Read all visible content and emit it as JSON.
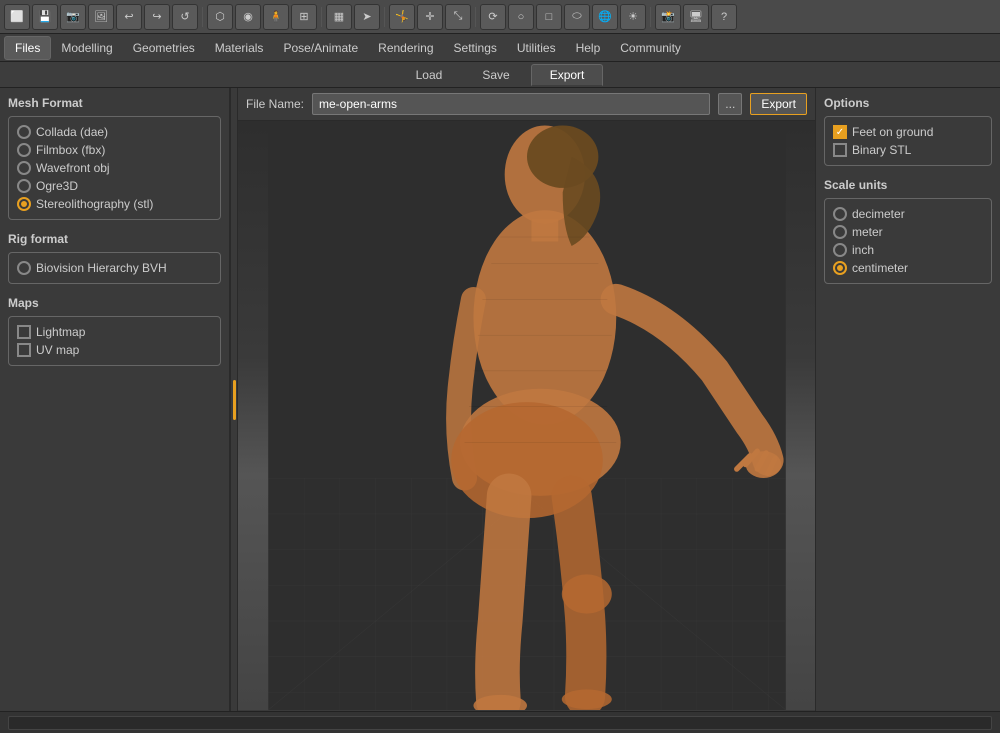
{
  "toolbar": {
    "tools": [
      {
        "name": "window-icon",
        "symbol": "⬜"
      },
      {
        "name": "disk-icon",
        "symbol": "💾"
      },
      {
        "name": "camera-icon",
        "symbol": "📷"
      },
      {
        "name": "render-icon",
        "symbol": "🖼"
      },
      {
        "name": "undo-icon",
        "symbol": "↩"
      },
      {
        "name": "redo-icon",
        "symbol": "↪"
      },
      {
        "name": "reset-icon",
        "symbol": "↺"
      },
      {
        "name": "mesh-icon",
        "symbol": "⬡"
      },
      {
        "name": "sphere-icon",
        "symbol": "◉"
      },
      {
        "name": "figure-icon",
        "symbol": "🧍"
      },
      {
        "name": "grid-icon",
        "symbol": "⊞"
      },
      {
        "name": "texture-icon",
        "symbol": "▦"
      },
      {
        "name": "arrow-icon",
        "symbol": "➤"
      },
      {
        "name": "pose-icon",
        "symbol": "🤸"
      },
      {
        "name": "move-icon",
        "symbol": "✛"
      },
      {
        "name": "scale-icon",
        "symbol": "⤡"
      },
      {
        "name": "rotate-icon",
        "symbol": "⟳"
      },
      {
        "name": "circle-icon",
        "symbol": "○"
      },
      {
        "name": "box-icon",
        "symbol": "□"
      },
      {
        "name": "cylinder-icon",
        "symbol": "⬭"
      },
      {
        "name": "globe-icon",
        "symbol": "🌐"
      },
      {
        "name": "light-icon",
        "symbol": "☀"
      },
      {
        "name": "camera2-icon",
        "symbol": "📸"
      },
      {
        "name": "screenshot-icon",
        "symbol": "🖥"
      },
      {
        "name": "help-icon",
        "symbol": "?"
      }
    ]
  },
  "menubar": {
    "items": [
      {
        "label": "Files",
        "active": true
      },
      {
        "label": "Modelling",
        "active": false
      },
      {
        "label": "Geometries",
        "active": false
      },
      {
        "label": "Materials",
        "active": false
      },
      {
        "label": "Pose/Animate",
        "active": false
      },
      {
        "label": "Rendering",
        "active": false
      },
      {
        "label": "Settings",
        "active": false
      },
      {
        "label": "Utilities",
        "active": false
      },
      {
        "label": "Help",
        "active": false
      },
      {
        "label": "Community",
        "active": false
      }
    ]
  },
  "subtabs": {
    "items": [
      {
        "label": "Load",
        "active": false
      },
      {
        "label": "Save",
        "active": false
      },
      {
        "label": "Export",
        "active": true
      }
    ]
  },
  "left_panel": {
    "mesh_format": {
      "title": "Mesh Format",
      "options": [
        {
          "label": "Collada (dae)",
          "checked": false,
          "type": "radio"
        },
        {
          "label": "Filmbox (fbx)",
          "checked": false,
          "type": "radio"
        },
        {
          "label": "Wavefront obj",
          "checked": false,
          "type": "radio"
        },
        {
          "label": "Ogre3D",
          "checked": false,
          "type": "radio"
        },
        {
          "label": "Stereolithography (stl)",
          "checked": true,
          "type": "radio"
        }
      ]
    },
    "rig_format": {
      "title": "Rig format",
      "options": [
        {
          "label": "Biovision Hierarchy BVH",
          "checked": false,
          "type": "radio"
        }
      ]
    },
    "maps": {
      "title": "Maps",
      "options": [
        {
          "label": "Lightmap",
          "checked": false,
          "type": "checkbox"
        },
        {
          "label": "UV map",
          "checked": false,
          "type": "checkbox"
        }
      ]
    }
  },
  "viewport": {
    "filename_label": "File Name:",
    "filename_value": "me-open-arms",
    "browse_label": "...",
    "export_label": "Export"
  },
  "right_panel": {
    "options": {
      "title": "Options",
      "items": [
        {
          "label": "Feet on ground",
          "checked": true,
          "type": "checkbox"
        },
        {
          "label": "Binary STL",
          "checked": false,
          "type": "checkbox"
        }
      ]
    },
    "scale_units": {
      "title": "Scale units",
      "items": [
        {
          "label": "decimeter",
          "checked": false,
          "type": "radio"
        },
        {
          "label": "meter",
          "checked": false,
          "type": "radio"
        },
        {
          "label": "inch",
          "checked": false,
          "type": "radio"
        },
        {
          "label": "centimeter",
          "checked": true,
          "type": "radio"
        }
      ]
    }
  },
  "statusbar": {
    "text": ""
  },
  "colors": {
    "accent": "#e8a020",
    "bg_dark": "#2a2a2a",
    "bg_mid": "#3a3a3a",
    "bg_light": "#4a4a4a"
  }
}
